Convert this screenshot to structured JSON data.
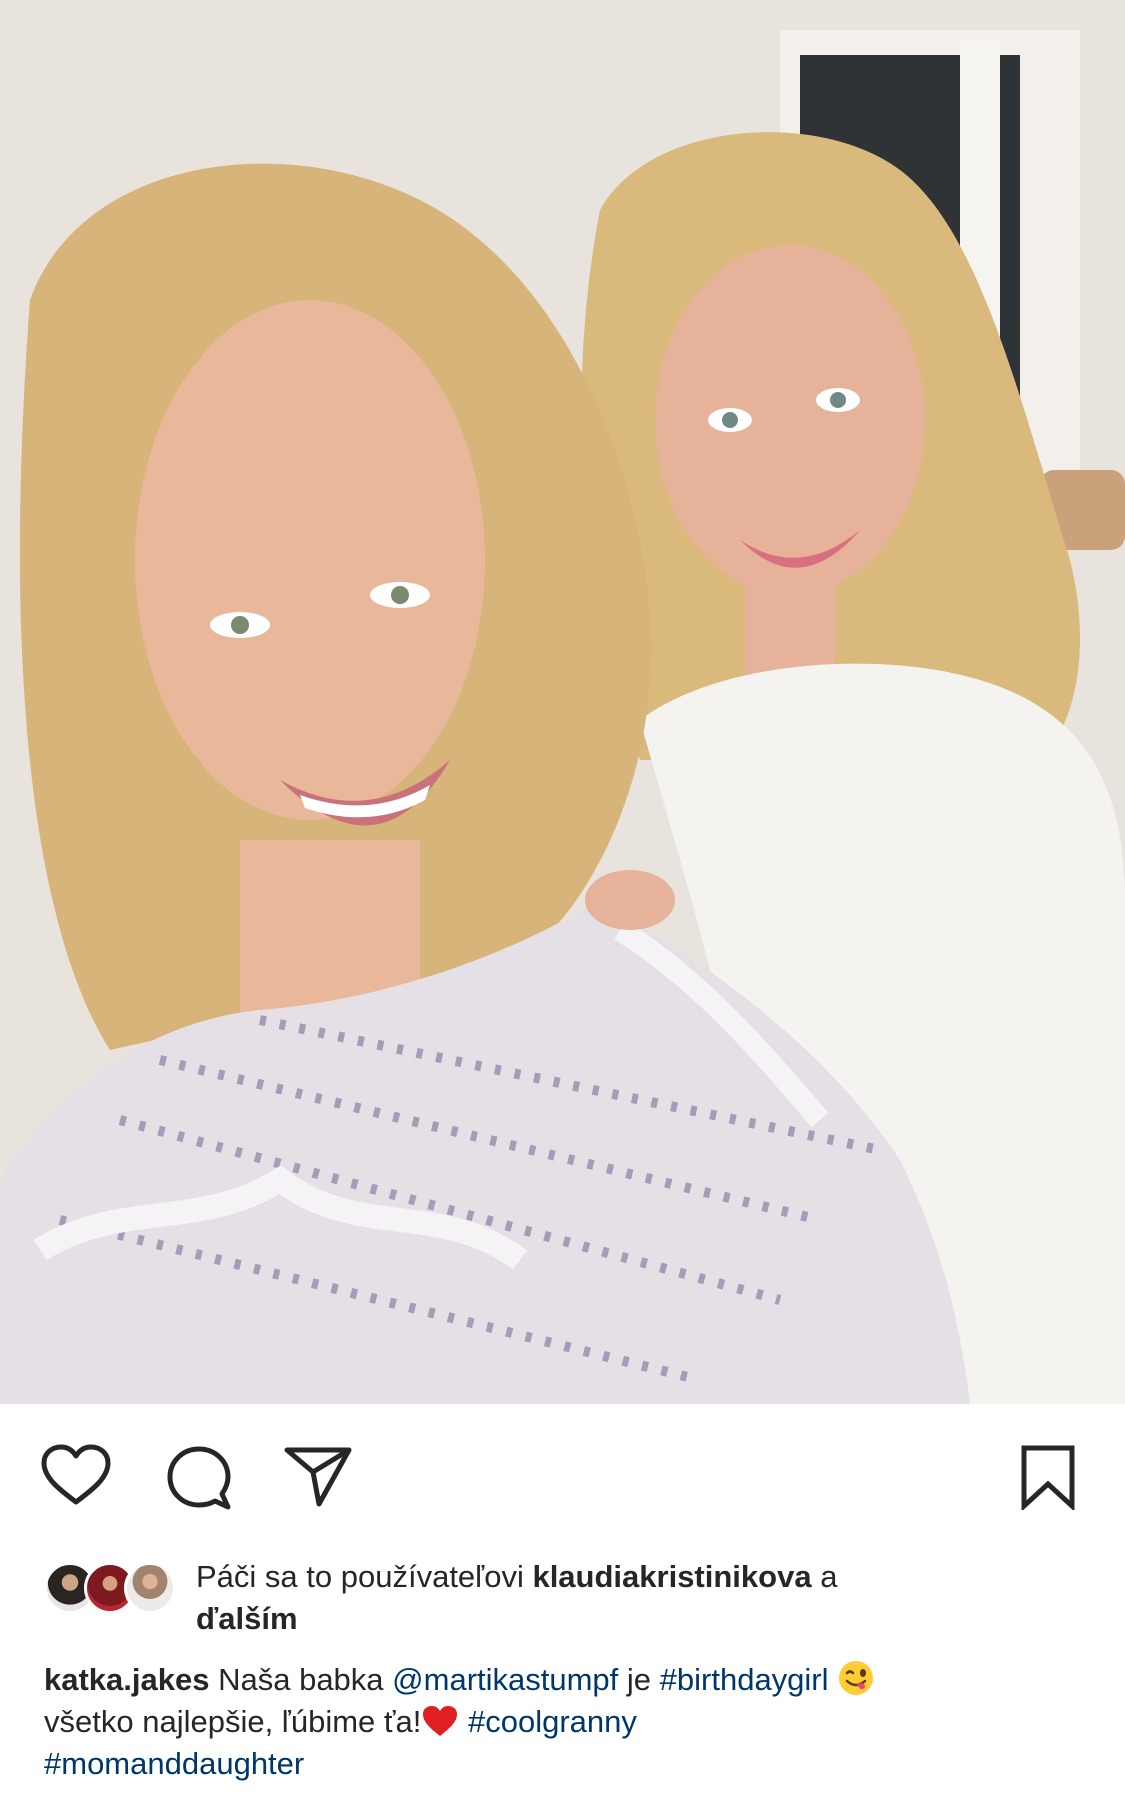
{
  "post": {
    "image_alt": "",
    "actions": {
      "like_icon": "heart-outline-icon",
      "comment_icon": "comment-bubble-icon",
      "share_icon": "paper-plane-icon",
      "save_icon": "bookmark-icon"
    },
    "likes": {
      "prefix": "Páči sa to používateľovi ",
      "user": "klaudiakristinikova",
      "joiner": " a",
      "others": "ďalším"
    },
    "caption": {
      "author": "katka.jakes",
      "text1": " Naša babka ",
      "mention": "@martikastumpf",
      "text2": " je ",
      "hashtag1": "#birthdaygirl",
      "emoji1": "winking-face-with-tongue-emoji",
      "line2": "všetko najlepšie, ľúbime ťa!",
      "emoji2": "red-heart-emoji",
      "hashtag2": "#coolgranny",
      "hashtag3": "#momanddaughter"
    }
  },
  "colors": {
    "text": "#262626",
    "link": "#00376b",
    "heart": "#e02020"
  }
}
